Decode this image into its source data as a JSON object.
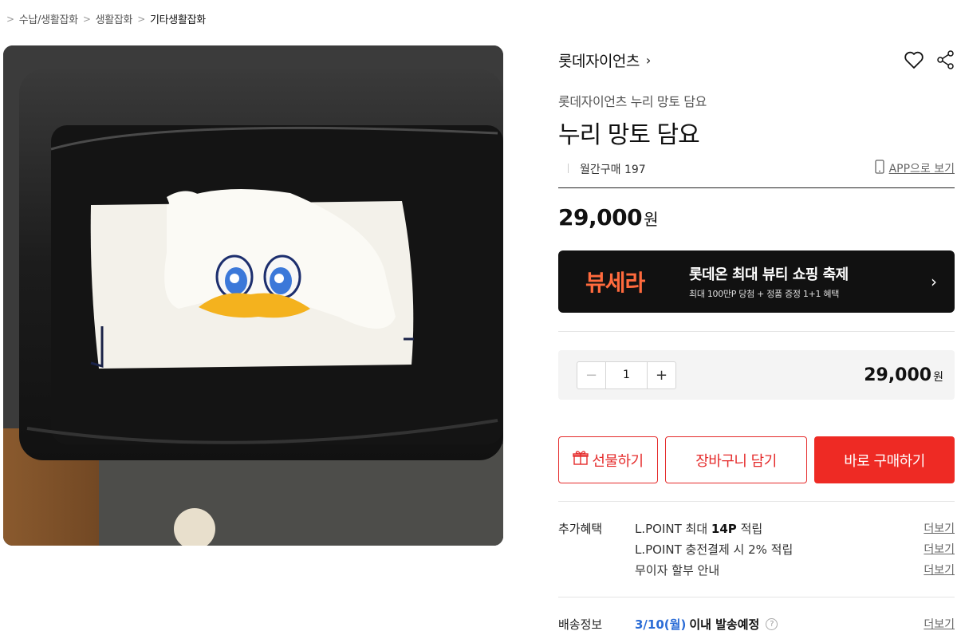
{
  "breadcrumb": {
    "sep1": ">",
    "cat1": "수납/생활잡화",
    "sep2": ">",
    "cat2": "생활잡화",
    "sep3": ">",
    "cat3": "기타생활잡화"
  },
  "product": {
    "brand": "롯데자이언츠",
    "brand_chevron": "›",
    "subtitle": "롯데자이언츠 누리 망토 담요",
    "title": "누리 망토 담요",
    "monthly_sales": "월간구매 197",
    "app_link": "APP으로 보기",
    "price": "29,000",
    "price_unit": "원"
  },
  "banner": {
    "logo": "뷰세라",
    "headline": "롯데온 최대 뷰티 쇼핑 축제",
    "subtext": "최대 100만P 당첨 + 정품 증정 1+1 혜택",
    "arrow": "›"
  },
  "quantity": {
    "minus": "−",
    "value": "1",
    "plus": "+",
    "total": "29,000",
    "total_unit": "원"
  },
  "actions": {
    "gift": "선물하기",
    "cart": "장바구니 담기",
    "buy": "바로 구매하기"
  },
  "benefits": {
    "label": "추가혜택",
    "rows": [
      {
        "prefix": "L.POINT 최대 ",
        "bold": "14P",
        "suffix": " 적립",
        "more": "더보기"
      },
      {
        "text": "L.POINT 충전결제 시 2% 적립",
        "more": "더보기"
      },
      {
        "text": "무이자 할부 안내",
        "more": "더보기"
      }
    ]
  },
  "delivery": {
    "label": "배송정보",
    "date": "3/10(월)",
    "rest": "이내 발송예정",
    "help": "?",
    "more": "더보기"
  },
  "colors": {
    "accent_red": "#ee2a24",
    "banner_bg": "#111111",
    "banner_logo": "#ff6a3d",
    "date_blue": "#2b6cd6"
  },
  "icons": [
    "heart-icon",
    "share-icon",
    "phone-icon",
    "gift-icon",
    "help-icon"
  ]
}
